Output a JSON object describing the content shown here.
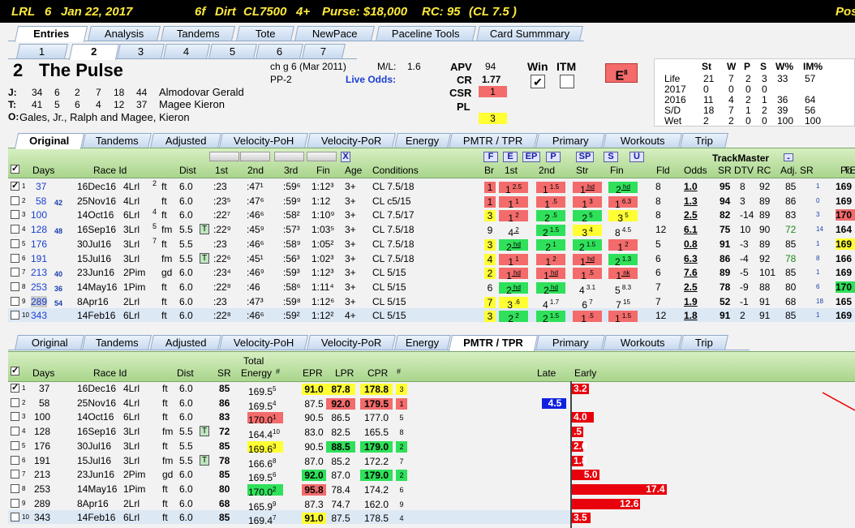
{
  "title": {
    "track": "LRL",
    "race": "6",
    "date": "Jan 22, 2017",
    "dist": "6f",
    "surface": "Dirt",
    "class": "CL7500",
    "age": "4+",
    "purse": "Purse: $18,000",
    "rc": "RC: 95",
    "cl": "(CL 7.5 )",
    "pos": "Pos"
  },
  "main_tabs": [
    "Entries",
    "Analysis",
    "Tandems",
    "Tote",
    "NewPace",
    "Paceline Tools",
    "Card Summmary"
  ],
  "post_tabs": [
    "1",
    "2",
    "3",
    "4",
    "5",
    "6",
    "7"
  ],
  "horse": {
    "pp": "2",
    "name": "The Pulse",
    "desc": "ch g 6  (Mar 2011)",
    "ml_label": "M/L:",
    "ml": "1.6",
    "pp_label": "PP-2",
    "live_odds": "Live Odds:",
    "jockey_label": "J:",
    "jockey_stats": [
      "34",
      "6",
      "2",
      "7",
      "18",
      "44"
    ],
    "jockey": "Almodovar Gerald",
    "trainer_label": "T:",
    "trainer_stats": [
      "41",
      "5",
      "6",
      "4",
      "12",
      "37"
    ],
    "trainer": "Magee Kieron",
    "owner_label": "O:",
    "owner": "Gales, Jr., Ralph and Magee, Kieron"
  },
  "ratings": {
    "apv_l": "APV",
    "apv": "94",
    "cr_l": "CR",
    "cr": "1.77",
    "csr_l": "CSR",
    "csr": "1",
    "pl_l": "PL",
    "pl": "3",
    "win_l": "Win",
    "itm_l": "ITM",
    "e_l": "E",
    "e_v": "8"
  },
  "life": {
    "hdr": [
      "St",
      "W",
      "P",
      "S",
      "W%",
      "IM%"
    ],
    "rows": [
      [
        "Life",
        "21",
        "7",
        "2",
        "3",
        "33",
        "57"
      ],
      [
        "2017",
        "0",
        "0",
        "0",
        "0",
        "",
        ""
      ],
      [
        "2016",
        "11",
        "4",
        "2",
        "1",
        "36",
        "64"
      ],
      [
        "S/D",
        "18",
        "7",
        "1",
        "2",
        "39",
        "56"
      ],
      [
        "Wet",
        "2",
        "2",
        "0",
        "0",
        "100",
        "100"
      ]
    ]
  },
  "sub_tabs": [
    "Original",
    "Tandems",
    "Adjusted",
    "Velocity-PoH",
    "Velocity-PoR",
    "Energy",
    "PMTR / TPR",
    "Primary",
    "Workouts",
    "Trip"
  ],
  "top_grid": {
    "cols": [
      "Days",
      "Race Id",
      "Dist",
      "1st",
      "2nd",
      "3rd",
      "Fin",
      "Age",
      "Conditions",
      "Br",
      "1st",
      "2nd",
      "Str",
      "Fin",
      "Fld",
      "Odds",
      "SR",
      "DTV",
      "RC",
      "Adj. SR",
      "Po",
      "TE"
    ],
    "btns": [
      "F",
      "E",
      "EP",
      "P",
      "SP",
      "S",
      "U"
    ],
    "trackmaster": "TrackMaster",
    "minus": "-",
    "x": "X",
    "rows": [
      [
        "1",
        "37",
        "",
        "16Dec16",
        "4Lrl",
        "2",
        "",
        "ft",
        "6.0",
        ":23",
        ":47¹",
        ":59⁶",
        "1:12³",
        "3+",
        "CL 7.5/18",
        "1",
        "1 2.5",
        "1 1.5",
        "1 hd",
        "2 hd",
        "8",
        "1.0",
        "95",
        "8",
        "92",
        "85",
        "1",
        "169"
      ],
      [
        "2",
        "58",
        "42",
        "25Nov16",
        "4Lrl",
        "",
        "",
        "ft",
        "6.0",
        ":23⁵",
        ":47⁶",
        ":59⁹",
        "1:12",
        "3+",
        "CL c5/15",
        "1",
        "1 1",
        "1 .5",
        "1 3",
        "1 6.3",
        "8",
        "1.3",
        "94",
        "3",
        "89",
        "86",
        "0",
        "169"
      ],
      [
        "3",
        "100",
        "",
        "14Oct16",
        "6Lrl",
        "4",
        "",
        "ft",
        "6.0",
        ":22⁷",
        ":46⁶",
        ":58²",
        "1:10⁹",
        "3+",
        "CL 7.5/17",
        "3",
        "1 2",
        "2 .5",
        "2 5",
        "3 5",
        "8",
        "2.5",
        "82",
        "-14",
        "89",
        "83",
        "3",
        "170"
      ],
      [
        "4",
        "128",
        "48",
        "16Sep16",
        "3Lrl",
        "5",
        "fm",
        "5.5",
        "T",
        ":22⁹",
        ":45⁹",
        ":57³",
        "1:03⁵",
        "3+",
        "CL 7.5/18",
        "9",
        "4 2",
        "2 1.5",
        "3 4",
        "8 4.5",
        "12",
        "6.1",
        "75",
        "10",
        "90",
        "72",
        "14",
        "164"
      ],
      [
        "5",
        "176",
        "",
        "30Jul16",
        "3Lrl",
        "7",
        "",
        "ft",
        "5.5",
        ":23",
        ":46⁶",
        ":58⁹",
        "1:05²",
        "3+",
        "CL 7.5/18",
        "3",
        "2 hd",
        "2 1",
        "2 1.5",
        "1 2",
        "5",
        "0.8",
        "91",
        "-3",
        "89",
        "85",
        "1",
        "169"
      ],
      [
        "6",
        "191",
        "",
        "15Jul16",
        "3Lrl",
        "",
        "fm",
        "5.5",
        "T",
        ":22⁶",
        ":45¹",
        ":56³",
        "1:02³",
        "3+",
        "CL 7.5/18",
        "4",
        "1 1",
        "1 2",
        "1 hd",
        "2 1.3",
        "6",
        "6.3",
        "86",
        "-4",
        "92",
        "78",
        "8",
        "166"
      ],
      [
        "7",
        "213",
        "40",
        "23Jun16",
        "2Pim",
        "",
        "gd",
        "6.0",
        "",
        ":23⁴",
        ":46⁹",
        ":59³",
        "1:12³",
        "3+",
        "CL 5/15",
        "2",
        "1 hd",
        "1 hd",
        "1 .5",
        "1 nk",
        "6",
        "7.6",
        "89",
        "-5",
        "101",
        "85",
        "1",
        "169"
      ],
      [
        "8",
        "253",
        "36",
        "14May16",
        "1Pim",
        "",
        "",
        "ft",
        "6.0",
        ":22⁸",
        ":46",
        ":58⁶",
        "1:11⁴",
        "3+",
        "CL 5/15",
        "6",
        "2 hd",
        "2 hd",
        "4 3.1",
        "5 8.3",
        "7",
        "2.5",
        "78",
        "-9",
        "88",
        "80",
        "6",
        "170"
      ],
      [
        "9",
        "289",
        "54",
        "8Apr16",
        "2Lrl",
        "",
        "",
        "ft",
        "6.0",
        ":23",
        ":47³",
        ":59⁸",
        "1:12⁶",
        "3+",
        "CL 5/15",
        "7",
        "3 .6",
        "4 1.7",
        "6 7",
        "7 15",
        "7",
        "1.9",
        "52",
        "-1",
        "91",
        "68",
        "18",
        "165"
      ],
      [
        "10",
        "343",
        "",
        "14Feb16",
        "6Lrl",
        "",
        "",
        "ft",
        "6.0",
        ":22⁸",
        ":46⁶",
        ":59²",
        "1:12²",
        "4+",
        "CL 5/15",
        "3",
        "2 2",
        "2 1.5",
        "1 .5",
        "1 1.5",
        "12",
        "1.8",
        "91",
        "2",
        "91",
        "85",
        "1",
        "169"
      ]
    ]
  },
  "bottom_grid": {
    "cols": [
      "Days",
      "Race Id",
      "Dist",
      "SR",
      "Total",
      "Energy",
      "#",
      "EPR",
      "LPR",
      "CPR",
      "#",
      "Late",
      "Early"
    ],
    "rows": [
      [
        "1",
        "37",
        "16Dec16",
        "4Lrl",
        "ft",
        "6.0",
        "",
        "85",
        "169.5",
        "5",
        "91.0",
        "87.8",
        "178.8",
        "3",
        "",
        "3.2"
      ],
      [
        "2",
        "58",
        "25Nov16",
        "4Lrl",
        "ft",
        "6.0",
        "",
        "86",
        "169.5",
        "4",
        "87.5",
        "92.0",
        "179.5",
        "1",
        "4.5",
        ""
      ],
      [
        "3",
        "100",
        "14Oct16",
        "6Lrl",
        "ft",
        "6.0",
        "",
        "83",
        "170.0",
        "1",
        "90.5",
        "86.5",
        "177.0",
        "5",
        "",
        "4.0"
      ],
      [
        "4",
        "128",
        "16Sep16",
        "3Lrl",
        "fm",
        "5.5",
        "T",
        "72",
        "164.4",
        "10",
        "83.0",
        "82.5",
        "165.5",
        "8",
        "",
        ".5"
      ],
      [
        "5",
        "176",
        "30Jul16",
        "3Lrl",
        "ft",
        "5.5",
        "",
        "85",
        "169.6",
        "3",
        "90.5",
        "88.5",
        "179.0",
        "2",
        "",
        "2.0"
      ],
      [
        "6",
        "191",
        "15Jul16",
        "3Lrl",
        "fm",
        "5.5",
        "T",
        "78",
        "166.6",
        "8",
        "87.0",
        "85.2",
        "172.2",
        "7",
        "",
        "1.8"
      ],
      [
        "7",
        "213",
        "23Jun16",
        "2Pim",
        "gd",
        "6.0",
        "",
        "85",
        "169.5",
        "6",
        "92.0",
        "87.0",
        "179.0",
        "2",
        "",
        "5.0"
      ],
      [
        "8",
        "253",
        "14May16",
        "1Pim",
        "ft",
        "6.0",
        "",
        "80",
        "170.0",
        "2",
        "95.8",
        "78.4",
        "174.2",
        "6",
        "",
        "17.4"
      ],
      [
        "9",
        "289",
        "8Apr16",
        "2Lrl",
        "ft",
        "6.0",
        "",
        "68",
        "165.9",
        "9",
        "87.3",
        "74.7",
        "162.0",
        "9",
        "",
        "12.6"
      ],
      [
        "10",
        "343",
        "14Feb16",
        "6Lrl",
        "ft",
        "6.0",
        "",
        "85",
        "169.4",
        "7",
        "91.0",
        "87.5",
        "178.5",
        "4",
        "",
        "3.5"
      ]
    ]
  },
  "colors": {
    "red": "#f36b6b",
    "green": "#2fe05a",
    "yellow": "#ffff33",
    "barred": "#e8000c",
    "blue": "#1020e0"
  }
}
